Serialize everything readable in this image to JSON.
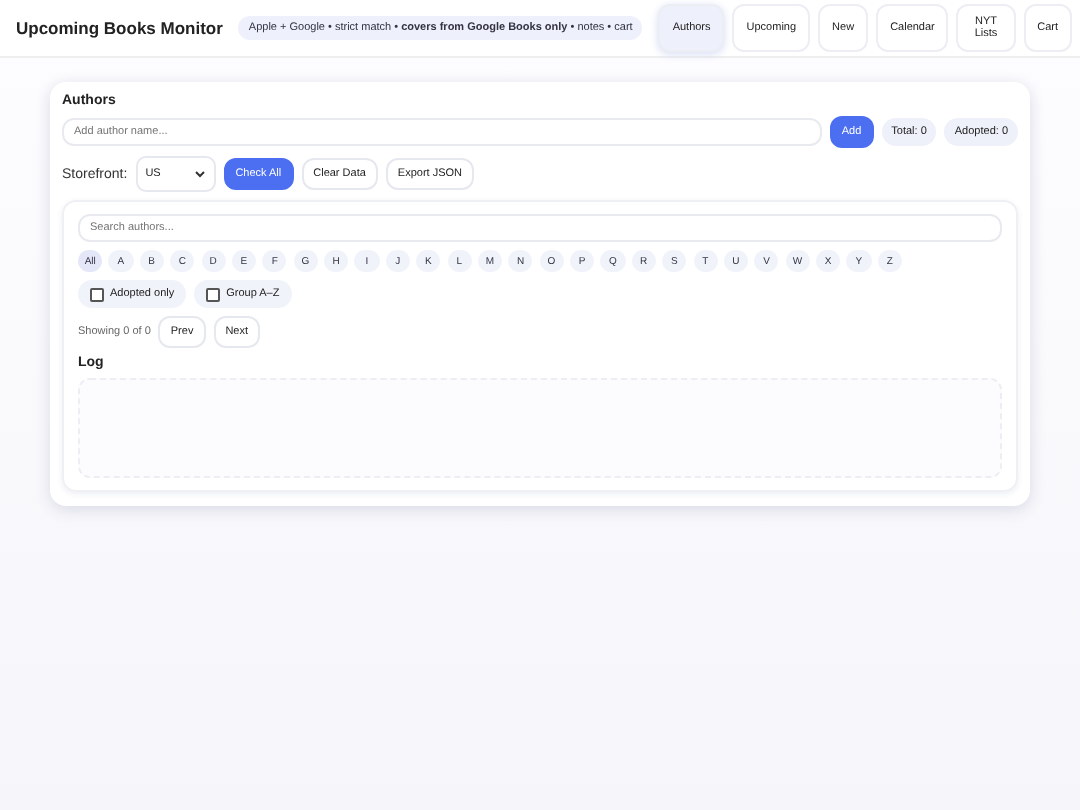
{
  "header": {
    "title": "Upcoming Books Monitor",
    "tagline": "Apple + Google • strict match • **covers from Google Books only** • notes • cart"
  },
  "nav": [
    {
      "label": "Authors",
      "selected": true
    },
    {
      "label": "Upcoming",
      "selected": false
    },
    {
      "label": "New",
      "selected": false
    },
    {
      "label": "Calendar",
      "selected": false
    },
    {
      "label": "NYT Lists",
      "selected": false
    },
    {
      "label": "Cart",
      "selected": false
    }
  ],
  "authors": {
    "title": "Authors",
    "add_field": {
      "placeholder": "Add author name..."
    },
    "add_button": "Add",
    "total": "Total: 0",
    "adopted": "Adopted: 0",
    "storefront_label": "Storefront:",
    "storefront": "US",
    "actions": [
      {
        "label": "Check All",
        "kind": "primary"
      },
      {
        "label": "Clear Data",
        "kind": "plain"
      },
      {
        "label": "Export JSON",
        "kind": "plain"
      }
    ]
  },
  "list": {
    "search": {
      "placeholder": "Search authors..."
    },
    "letters": [
      {
        "label": "All",
        "selected": true
      },
      {
        "label": "A",
        "selected": false
      },
      {
        "label": "B",
        "selected": false
      },
      {
        "label": "C",
        "selected": false
      },
      {
        "label": "D",
        "selected": false
      },
      {
        "label": "E",
        "selected": false
      },
      {
        "label": "F",
        "selected": false
      },
      {
        "label": "G",
        "selected": false
      },
      {
        "label": "H",
        "selected": false
      },
      {
        "label": "I",
        "selected": false
      },
      {
        "label": "J",
        "selected": false
      },
      {
        "label": "K",
        "selected": false
      },
      {
        "label": "L",
        "selected": false
      },
      {
        "label": "M",
        "selected": false
      },
      {
        "label": "N",
        "selected": false
      },
      {
        "label": "O",
        "selected": false
      },
      {
        "label": "P",
        "selected": false
      },
      {
        "label": "Q",
        "selected": false
      },
      {
        "label": "R",
        "selected": false
      },
      {
        "label": "S",
        "selected": false
      },
      {
        "label": "T",
        "selected": false
      },
      {
        "label": "U",
        "selected": false
      },
      {
        "label": "V",
        "selected": false
      },
      {
        "label": "W",
        "selected": false
      },
      {
        "label": "X",
        "selected": false
      },
      {
        "label": "Y",
        "selected": false
      },
      {
        "label": "Z",
        "selected": false
      }
    ],
    "filters": [
      {
        "label": "Adopted only",
        "checked": false
      },
      {
        "label": "Group A–Z",
        "checked": false
      }
    ],
    "showing": "Showing 0 of 0",
    "prev": "Prev",
    "next": "Next",
    "log_title": "Log"
  }
}
